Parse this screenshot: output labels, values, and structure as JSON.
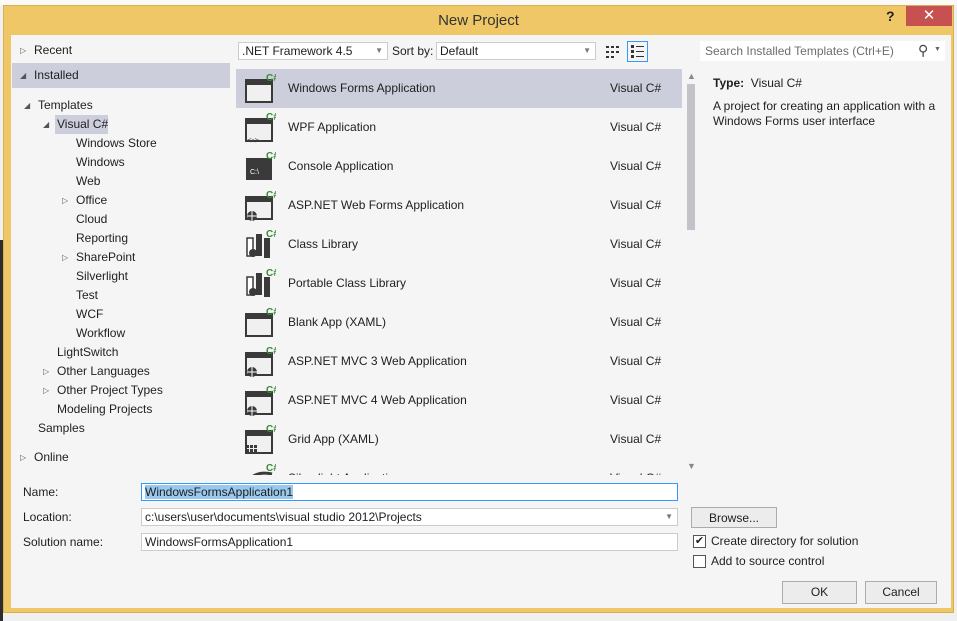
{
  "window": {
    "title": "New Project",
    "help": "?",
    "close": "✕"
  },
  "tree": {
    "recent": "Recent",
    "installed": "Installed",
    "templates": "Templates",
    "visual_csharp": "Visual C#",
    "csharp_children": [
      "Windows Store",
      "Windows",
      "Web",
      "Office",
      "Cloud",
      "Reporting",
      "SharePoint",
      "Silverlight",
      "Test",
      "WCF",
      "Workflow"
    ],
    "lightswitch": "LightSwitch",
    "other_languages": "Other Languages",
    "other_project_types": "Other Project Types",
    "modeling_projects": "Modeling Projects",
    "samples": "Samples",
    "online": "Online"
  },
  "toolbar": {
    "framework": ".NET Framework 4.5",
    "sort_label": "Sort by:",
    "sort_value": "Default",
    "search_placeholder": "Search Installed Templates (Ctrl+E)"
  },
  "templates": [
    {
      "name": "Windows Forms Application",
      "lang": "Visual C#",
      "icon": "winforms"
    },
    {
      "name": "WPF Application",
      "lang": "Visual C#",
      "icon": "wpf"
    },
    {
      "name": "Console Application",
      "lang": "Visual C#",
      "icon": "console"
    },
    {
      "name": "ASP.NET Web Forms Application",
      "lang": "Visual C#",
      "icon": "web"
    },
    {
      "name": "Class Library",
      "lang": "Visual C#",
      "icon": "library"
    },
    {
      "name": "Portable Class Library",
      "lang": "Visual C#",
      "icon": "library"
    },
    {
      "name": "Blank App (XAML)",
      "lang": "Visual C#",
      "icon": "blank"
    },
    {
      "name": "ASP.NET MVC 3 Web Application",
      "lang": "Visual C#",
      "icon": "web"
    },
    {
      "name": "ASP.NET MVC 4 Web Application",
      "lang": "Visual C#",
      "icon": "web"
    },
    {
      "name": "Grid App (XAML)",
      "lang": "Visual C#",
      "icon": "grid"
    },
    {
      "name": "Silverlight Application",
      "lang": "Visual C#",
      "icon": "silverlight"
    }
  ],
  "details": {
    "type_label": "Type:",
    "type_value": "Visual C#",
    "description": "A project for creating an application with a Windows Forms user interface"
  },
  "form": {
    "name_label": "Name:",
    "name_value": "WindowsFormsApplication1",
    "location_label": "Location:",
    "location_value": "c:\\users\\user\\documents\\visual studio 2012\\Projects",
    "browse": "Browse...",
    "solution_label": "Solution name:",
    "solution_value": "WindowsFormsApplication1",
    "create_dir": "Create directory for solution",
    "create_dir_checked": true,
    "source_control": "Add to source control",
    "source_control_checked": false,
    "ok": "OK",
    "cancel": "Cancel"
  },
  "colors": {
    "frame": "#efc766",
    "selection": "#cccedb",
    "close": "#c75050",
    "csharp_badge": "#388a34"
  }
}
